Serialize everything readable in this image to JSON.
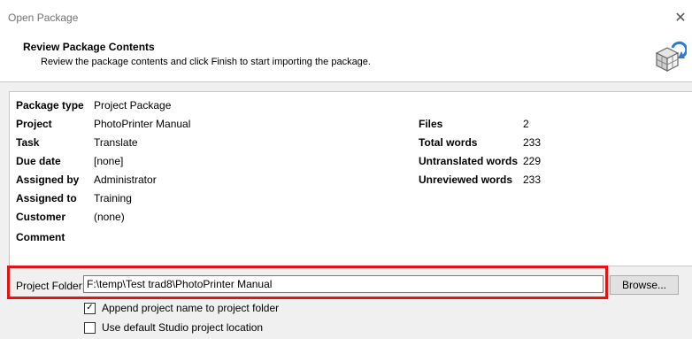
{
  "window": {
    "title": "Open Package"
  },
  "header": {
    "title": "Review Package Contents",
    "subtitle": "Review the package contents and click Finish to start importing the package."
  },
  "info": {
    "left": [
      {
        "label": "Package type",
        "value": "Project Package"
      },
      {
        "label": "Project",
        "value": "PhotoPrinter Manual"
      },
      {
        "label": "Task",
        "value": "Translate"
      },
      {
        "label": "Due date",
        "value": "[none]"
      },
      {
        "label": "Assigned by",
        "value": "Administrator"
      },
      {
        "label": "Assigned to",
        "value": "Training"
      },
      {
        "label": "Customer",
        "value": "(none)"
      },
      {
        "label": "Comment",
        "value": ""
      }
    ],
    "right": [
      {
        "label": "Files",
        "value": "2"
      },
      {
        "label": "Total words",
        "value": "233"
      },
      {
        "label": "Untranslated words",
        "value": "229"
      },
      {
        "label": "Unreviewed words",
        "value": "233"
      }
    ]
  },
  "folder": {
    "label": "Project Folder:",
    "value": "F:\\temp\\Test trad8\\PhotoPrinter Manual",
    "browse_label": "Browse..."
  },
  "options": [
    {
      "label": "Append project name to project folder",
      "checked": true
    },
    {
      "label": "Use default Studio project location",
      "checked": false
    }
  ],
  "colors": {
    "highlight": "#e01515"
  }
}
